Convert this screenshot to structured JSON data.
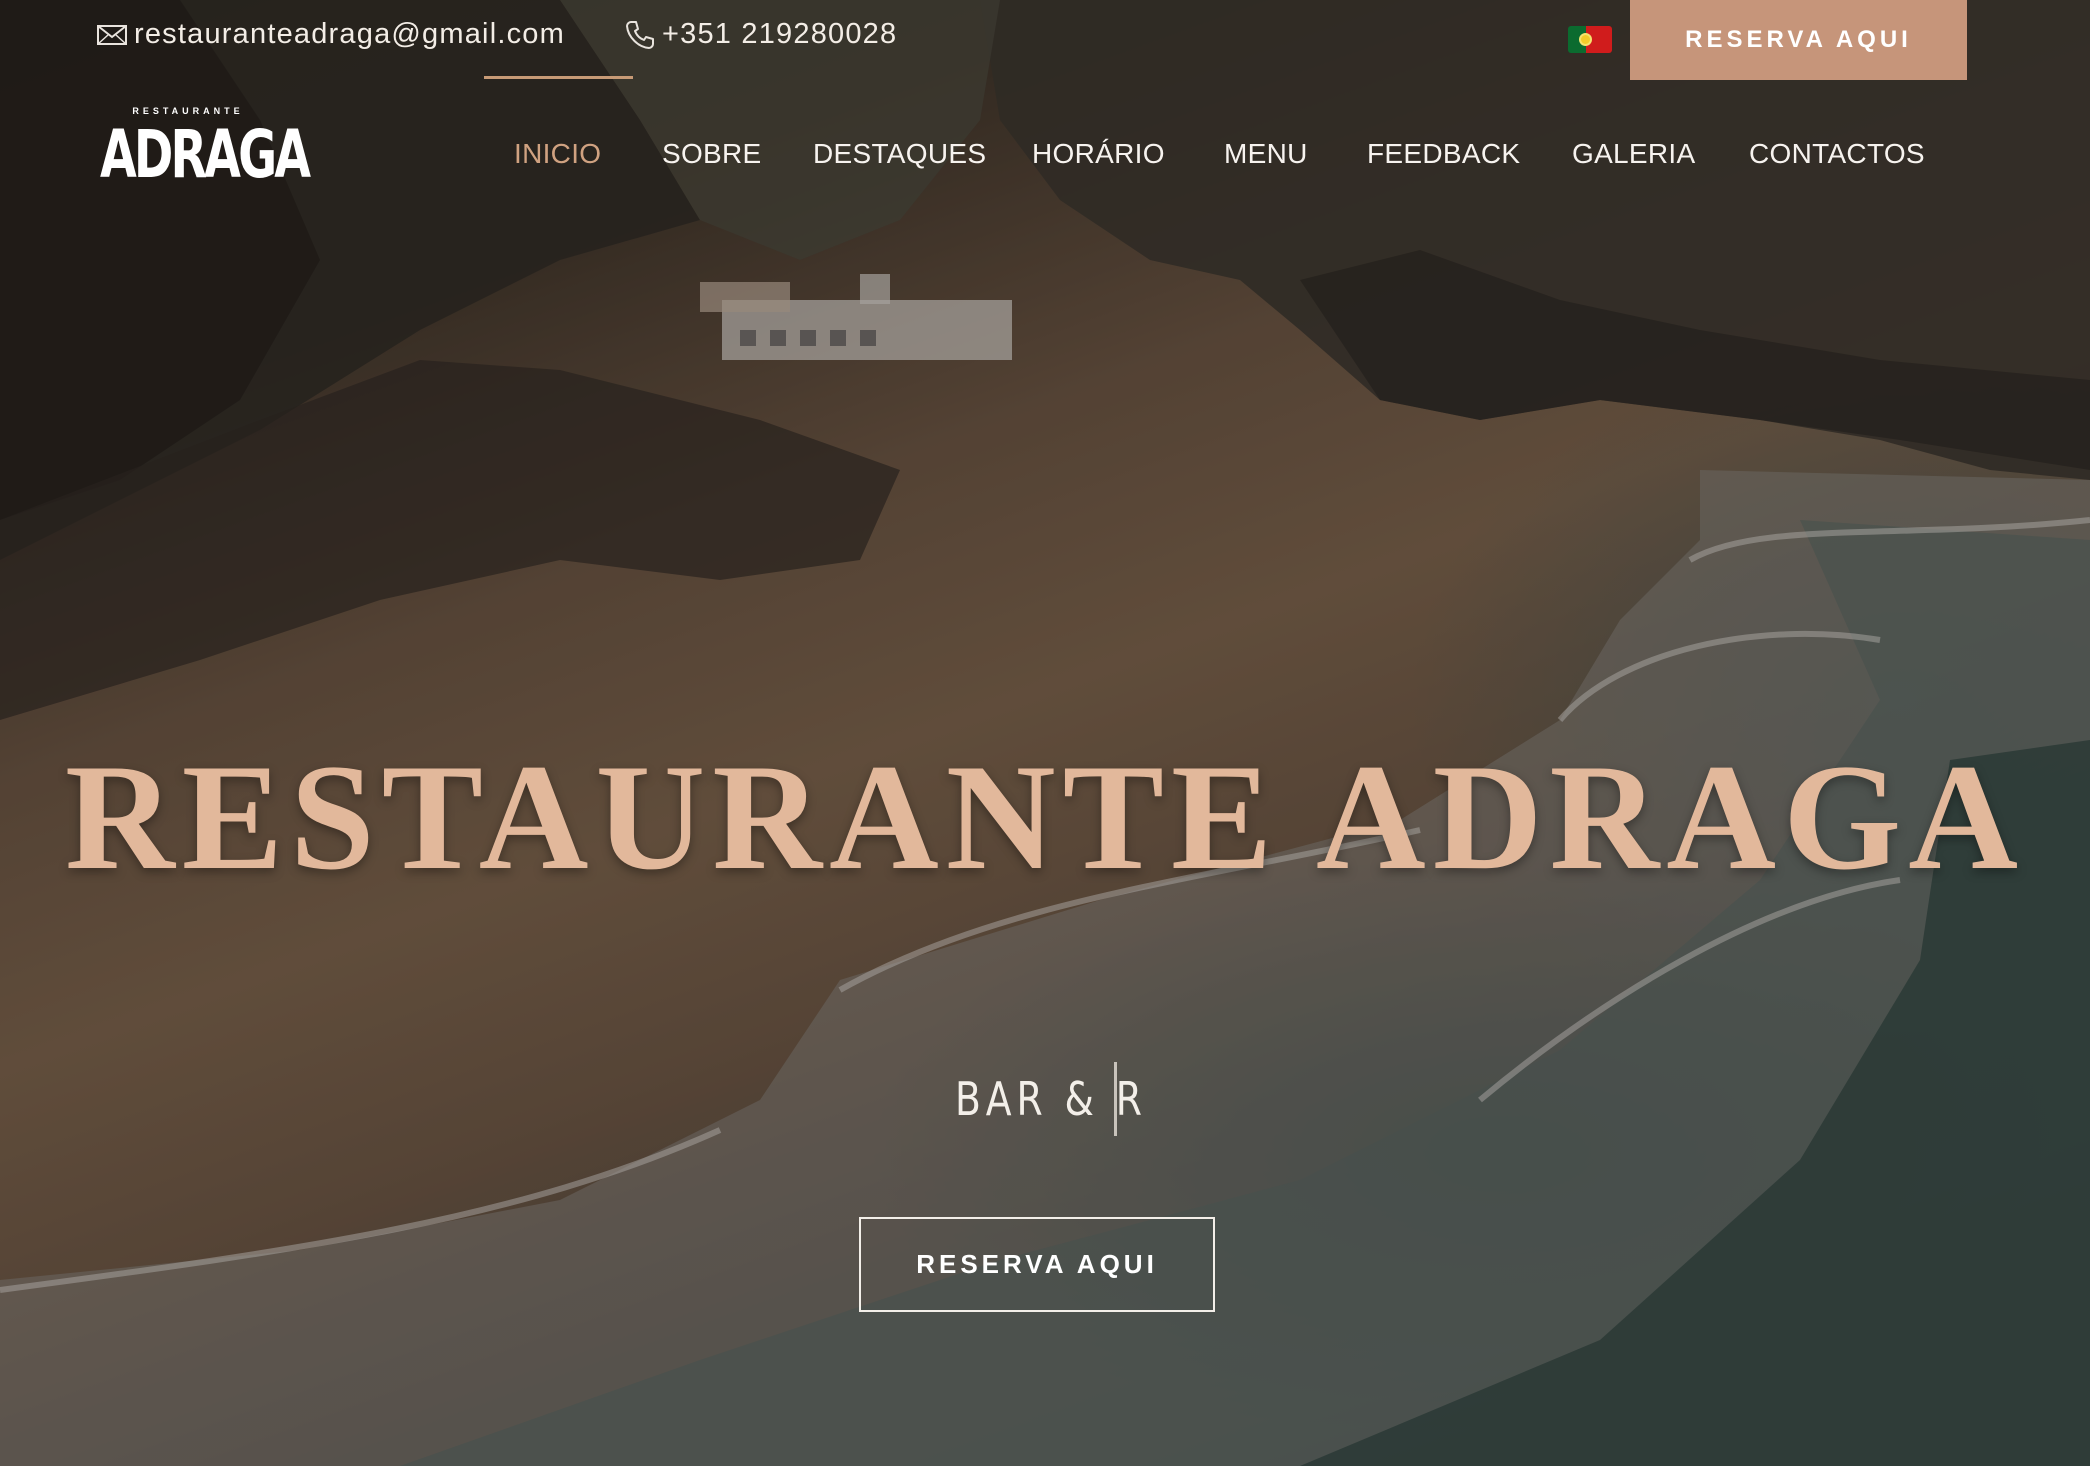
{
  "topbar": {
    "email": "restauranteadraga@gmail.com",
    "phone": "+351 219280028",
    "reserve_label": "RESERVA AQUI",
    "language_flag": "portugal-flag"
  },
  "logo": {
    "small": "RESTAURANTE",
    "big": "ADRAGA"
  },
  "nav": {
    "items": [
      {
        "label": "INICIO",
        "active": true
      },
      {
        "label": "SOBRE"
      },
      {
        "label": "DESTAQUES"
      },
      {
        "label": "HORÁRIO"
      },
      {
        "label": "MENU"
      },
      {
        "label": "FEEDBACK"
      },
      {
        "label": "GALERIA"
      },
      {
        "label": "CONTACTOS"
      }
    ]
  },
  "hero": {
    "title": "RESTAURANTE ADRAGA",
    "typed_text": "BAR & R",
    "reserve_label": "RESERVA AQUI"
  },
  "colors": {
    "accent": "#c6957a",
    "nav_active": "#d0a281",
    "headline": "#e2b89b"
  },
  "icons": {
    "email": "envelope-icon",
    "phone": "phone-icon"
  }
}
